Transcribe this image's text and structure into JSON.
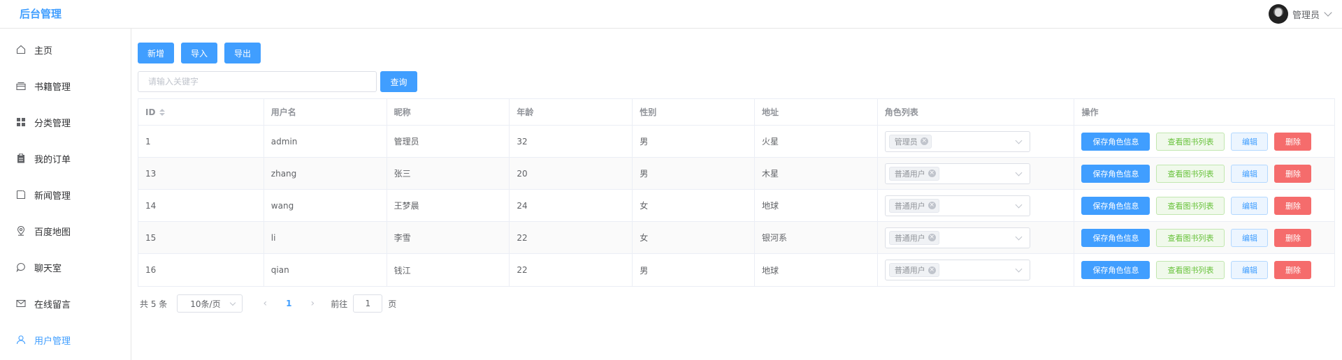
{
  "header": {
    "brand": "后台管理",
    "user_name": "管理员"
  },
  "sidebar": {
    "items": [
      {
        "label": "主页",
        "icon": "home-icon"
      },
      {
        "label": "书籍管理",
        "icon": "books-icon"
      },
      {
        "label": "分类管理",
        "icon": "grid-icon"
      },
      {
        "label": "我的订单",
        "icon": "clipboard-icon"
      },
      {
        "label": "新闻管理",
        "icon": "news-icon"
      },
      {
        "label": "百度地图",
        "icon": "map-pin-icon"
      },
      {
        "label": "聊天室",
        "icon": "chat-icon"
      },
      {
        "label": "在线留言",
        "icon": "mail-icon"
      },
      {
        "label": "用户管理",
        "icon": "user-icon",
        "active": true
      }
    ]
  },
  "toolbar": {
    "add_label": "新增",
    "import_label": "导入",
    "export_label": "导出"
  },
  "search": {
    "placeholder": "请输入关键字",
    "value": "",
    "button_label": "查询"
  },
  "table": {
    "headers": [
      "ID",
      "用户名",
      "昵称",
      "年龄",
      "性别",
      "地址",
      "角色列表",
      "操作"
    ],
    "rows": [
      {
        "id": "1",
        "username": "admin",
        "nickname": "管理员",
        "age": "32",
        "gender": "男",
        "address": "火星",
        "role": "管理员"
      },
      {
        "id": "13",
        "username": "zhang",
        "nickname": "张三",
        "age": "20",
        "gender": "男",
        "address": "木星",
        "role": "普通用户"
      },
      {
        "id": "14",
        "username": "wang",
        "nickname": "王梦晨",
        "age": "24",
        "gender": "女",
        "address": "地球",
        "role": "普通用户"
      },
      {
        "id": "15",
        "username": "li",
        "nickname": "李雪",
        "age": "22",
        "gender": "女",
        "address": "银河系",
        "role": "普通用户"
      },
      {
        "id": "16",
        "username": "qian",
        "nickname": "钱江",
        "age": "22",
        "gender": "男",
        "address": "地球",
        "role": "普通用户"
      }
    ],
    "actions": {
      "save": "保存角色信息",
      "view": "查看图书列表",
      "edit": "编辑",
      "delete": "删除"
    }
  },
  "pagination": {
    "total_label": "共 5 条",
    "page_size": "10条/页",
    "current_page": "1",
    "goto_label": "前往",
    "goto_value": "1",
    "page_suffix": "页"
  },
  "colors": {
    "primary": "#409eff",
    "success": "#67c23a",
    "danger": "#f56c6c"
  }
}
